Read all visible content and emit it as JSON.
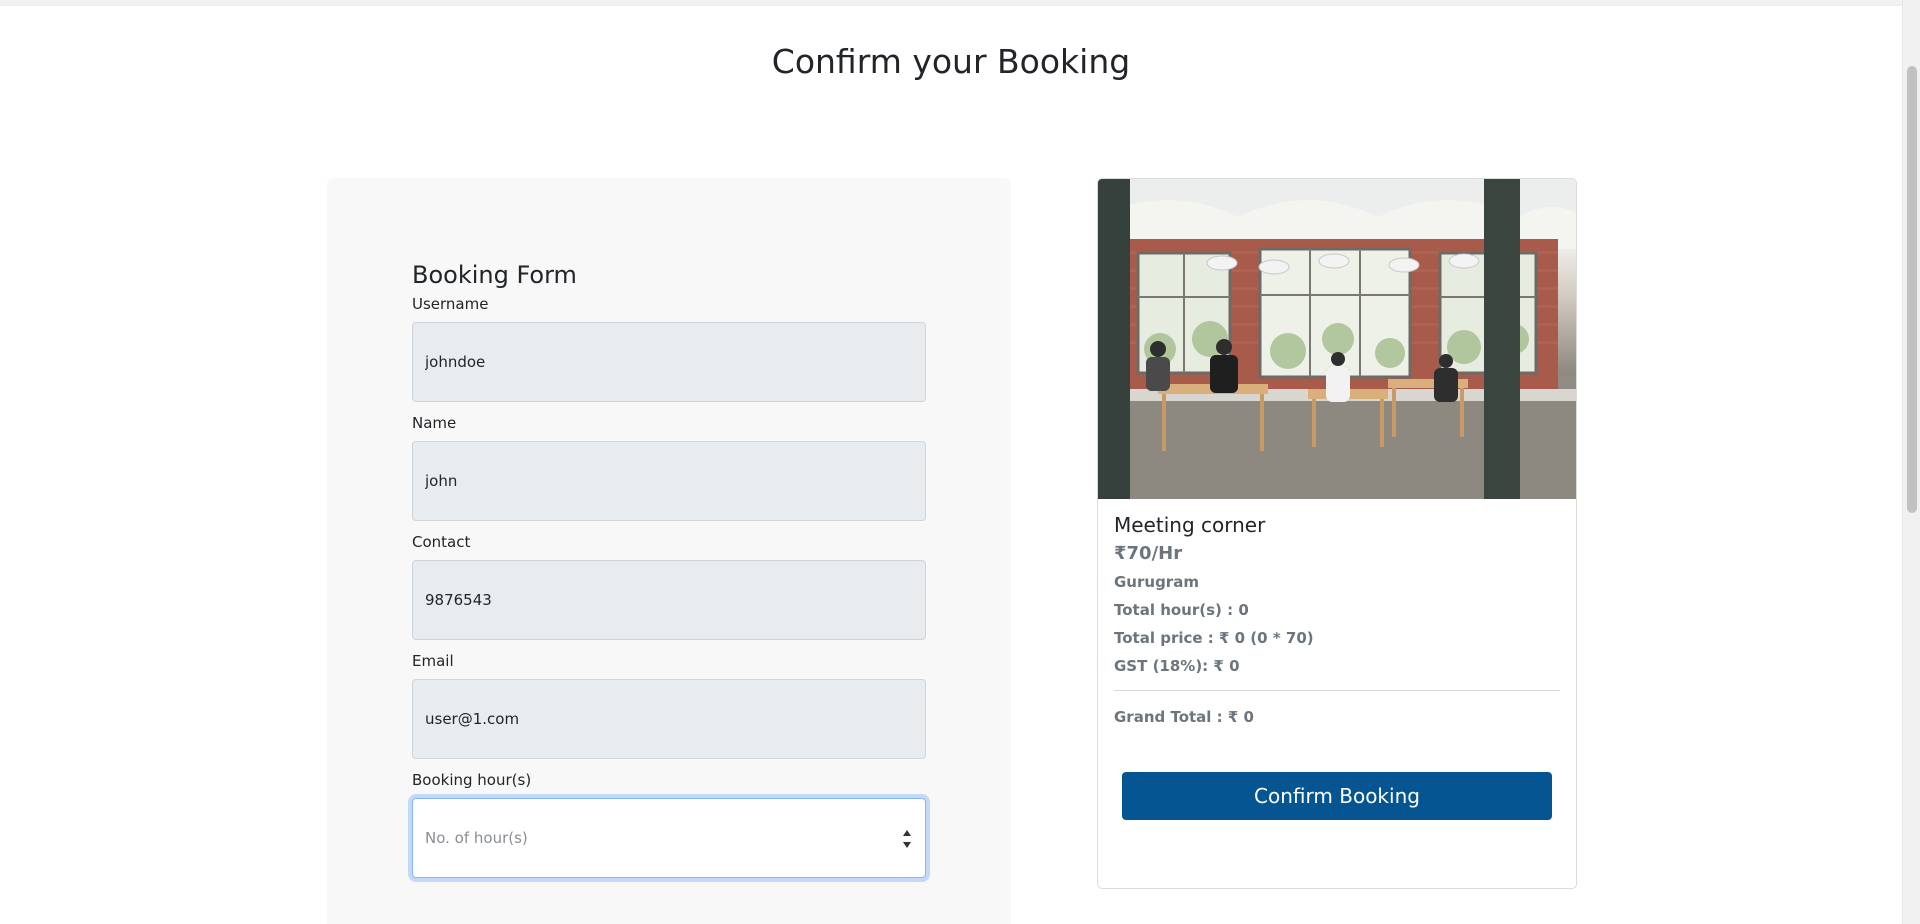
{
  "page": {
    "title": "Confirm your Booking"
  },
  "form": {
    "title": "Booking Form",
    "fields": {
      "username": {
        "label": "Username",
        "value": "johndoe"
      },
      "name": {
        "label": "Name",
        "value": "john"
      },
      "contact": {
        "label": "Contact",
        "value": "9876543"
      },
      "email": {
        "label": "Email",
        "value": "user@1.com"
      },
      "hours": {
        "label": "Booking hour(s)",
        "value": "",
        "placeholder": "No. of hour(s)"
      }
    }
  },
  "space": {
    "image_alt": "Meeting corner",
    "name": "Meeting corner",
    "price": "₹70/Hr",
    "location": "Gurugram",
    "total_hours": "Total hour(s) : 0",
    "total_price": "Total price : ₹ 0 (0 * 70)",
    "gst": "GST (18%): ₹ 0",
    "grand_total": "Grand Total : ₹ 0",
    "confirm_label": "Confirm Booking"
  },
  "colors": {
    "accent": "#055592",
    "panel_bg": "#f8f8f8",
    "input_bg": "#e9ecef",
    "muted_text": "#6c757d"
  }
}
